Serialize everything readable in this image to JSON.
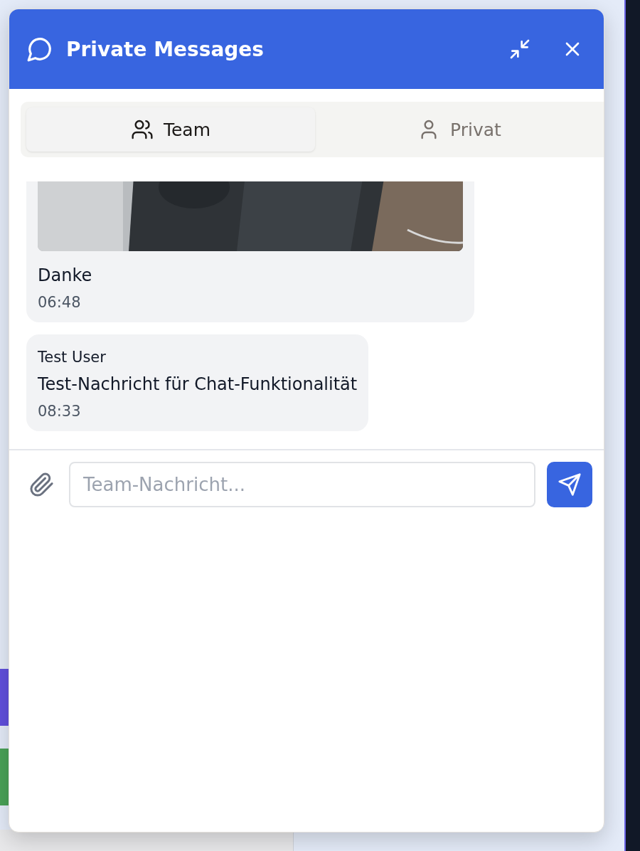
{
  "window": {
    "title": "Private Messages"
  },
  "tabs": [
    {
      "label": "Team",
      "selected": true
    },
    {
      "label": "Privat",
      "selected": false
    }
  ],
  "messages": [
    {
      "text": "Danke",
      "time": "06:48"
    },
    {
      "kind": "text",
      "sender": "Test User",
      "text": "Test-Nachricht für Chat-Funktionalität",
      "time": "08:33"
    }
  ],
  "composer": {
    "placeholder": "Team-Nachricht..."
  }
}
